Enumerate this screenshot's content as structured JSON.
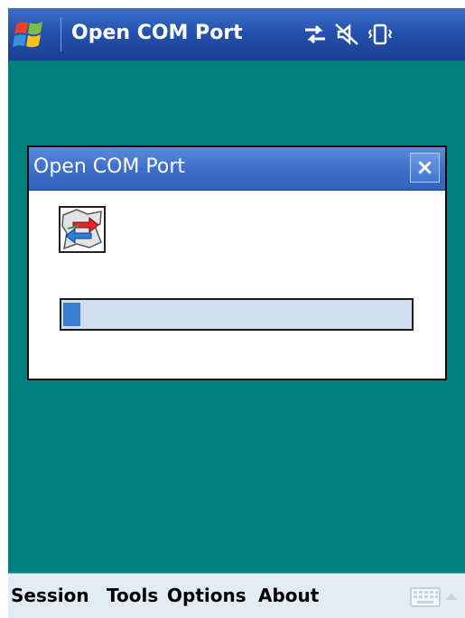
{
  "titlebar": {
    "title": "Open COM Port",
    "start_icon": "windows-flag-icon",
    "tray_icons": [
      "connectivity-icon",
      "speaker-muted-icon",
      "vibrate-icon"
    ]
  },
  "dialog": {
    "title": "Open COM Port",
    "close_label": "×",
    "icon": "com-port-transfer-icon",
    "progress": 0.05
  },
  "menubar": {
    "items": [
      "Session",
      "Tools",
      "Options",
      "About"
    ],
    "input_icon": "keyboard-icon",
    "input_arrow_icon": "arrow-up-icon"
  },
  "colors": {
    "desktop": "#00807f",
    "titlebar": "#2452ad",
    "progress_fill": "#3c7fd0",
    "progress_track": "#cfdef0"
  }
}
